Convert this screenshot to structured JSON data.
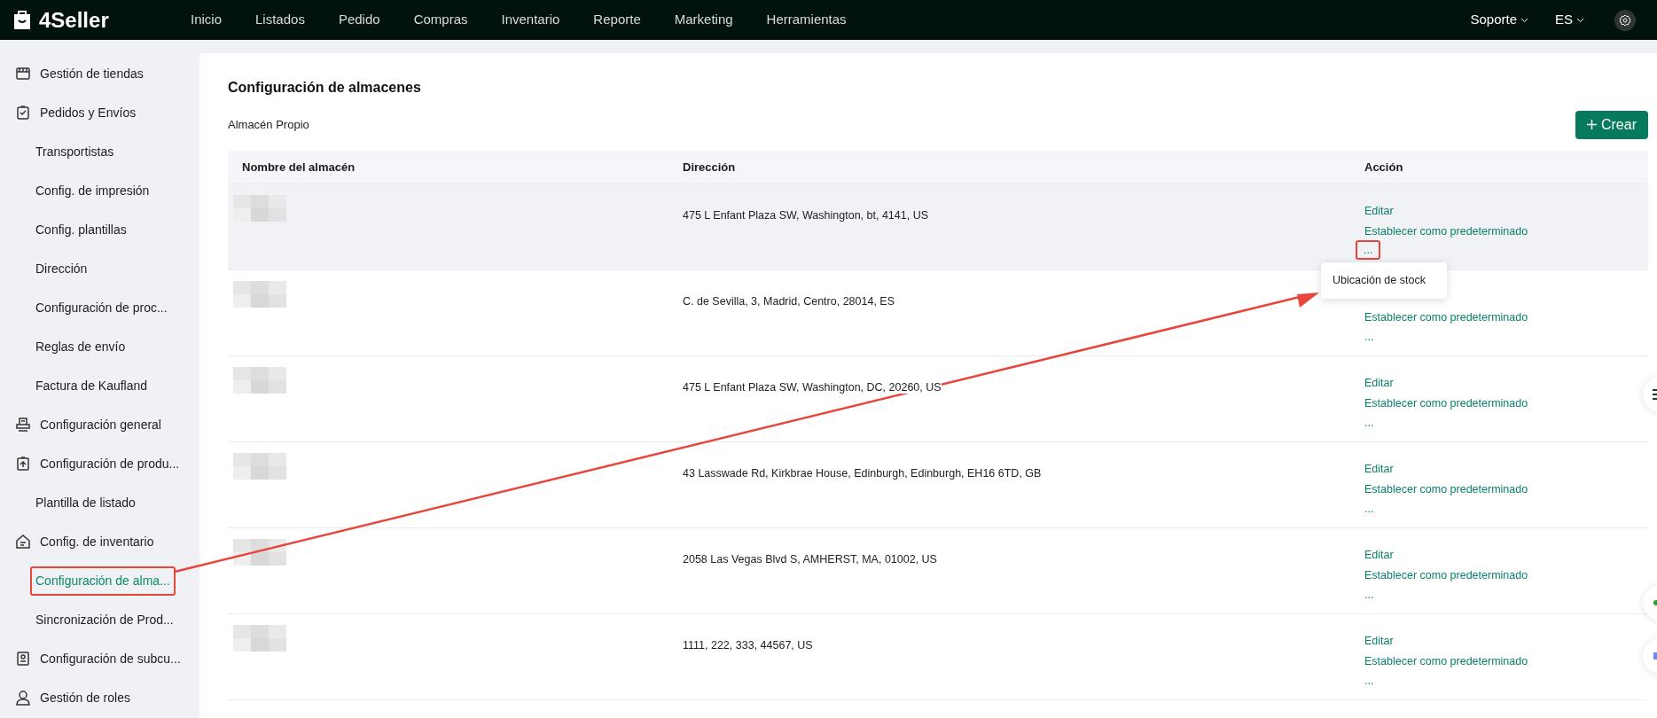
{
  "logo": "4Seller",
  "nav": [
    "Inicio",
    "Listados",
    "Pedido",
    "Compras",
    "Inventario",
    "Reporte",
    "Marketing",
    "Herramientas"
  ],
  "support": "Soporte",
  "language": "ES",
  "sidebar": {
    "items": [
      {
        "label": "Gestión de tiendas",
        "kind": "group",
        "selected": false,
        "callout": false
      },
      {
        "label": "Pedidos y Envíos",
        "kind": "group",
        "selected": false,
        "callout": false
      },
      {
        "label": "Transportistas",
        "kind": "sub",
        "selected": false,
        "callout": false
      },
      {
        "label": "Config. de impresión",
        "kind": "sub",
        "selected": false,
        "callout": false
      },
      {
        "label": "Config. plantillas",
        "kind": "sub",
        "selected": false,
        "callout": false
      },
      {
        "label": "Dirección",
        "kind": "sub",
        "selected": false,
        "callout": false
      },
      {
        "label": "Configuración de proc...",
        "kind": "sub",
        "selected": false,
        "callout": false
      },
      {
        "label": "Reglas de envío",
        "kind": "sub",
        "selected": false,
        "callout": false
      },
      {
        "label": "Factura de Kaufland",
        "kind": "sub",
        "selected": false,
        "callout": false
      },
      {
        "label": "Configuración general",
        "kind": "group",
        "selected": false,
        "callout": false
      },
      {
        "label": "Configuración de produ...",
        "kind": "group",
        "selected": false,
        "callout": false
      },
      {
        "label": "Plantilla de listado",
        "kind": "sub",
        "selected": false,
        "callout": false
      },
      {
        "label": "Config. de inventario",
        "kind": "group",
        "selected": false,
        "callout": false
      },
      {
        "label": "Configuración de alma...",
        "kind": "sub",
        "selected": true,
        "callout": true
      },
      {
        "label": "Sincronización de Prod...",
        "kind": "sub",
        "selected": false,
        "callout": false
      },
      {
        "label": "Configuración de subcu...",
        "kind": "group",
        "selected": false,
        "callout": false
      },
      {
        "label": "Gestión de roles",
        "kind": "group",
        "selected": false,
        "callout": false
      }
    ]
  },
  "page": {
    "title": "Configuración de almacenes",
    "section": "Almacén Propio",
    "create_button": "Crear"
  },
  "table": {
    "columns": [
      "Nombre del almacén",
      "Dirección",
      "Acción"
    ],
    "rows": [
      {
        "address": "475 L Enfant Plaza SW, Washington, bt, 4141, US",
        "highlighted": true,
        "actions": [
          "Editar",
          "Establecer como predeterminado"
        ],
        "more": "...",
        "more_callout": true
      },
      {
        "address": "C. de Sevilla, 3, Madrid, Centro, 28014, ES",
        "highlighted": false,
        "actions": [
          "Establecer como predeterminado"
        ],
        "more": "...",
        "more_callout": false
      },
      {
        "address": "475 L Enfant Plaza SW, Washington, DC, 20260, US",
        "highlighted": false,
        "actions": [
          "Editar",
          "Establecer como predeterminado"
        ],
        "more": "...",
        "more_callout": false
      },
      {
        "address": "43 Lasswade Rd, Kirkbrae House, Edinburgh, Edinburgh, EH16 6TD, GB",
        "highlighted": false,
        "actions": [
          "Editar",
          "Establecer como predeterminado"
        ],
        "more": "...",
        "more_callout": false
      },
      {
        "address": "2058 Las Vegas Blvd S, AMHERST, MA, 01002, US",
        "highlighted": false,
        "actions": [
          "Editar",
          "Establecer como predeterminado"
        ],
        "more": "...",
        "more_callout": false
      },
      {
        "address": "1111, 222, 333, 44567, US",
        "highlighted": false,
        "actions": [
          "Editar",
          "Establecer como predeterminado"
        ],
        "more": "...",
        "more_callout": false
      }
    ]
  },
  "dropdown_menu": {
    "items": [
      "Ubicación de stock"
    ]
  }
}
